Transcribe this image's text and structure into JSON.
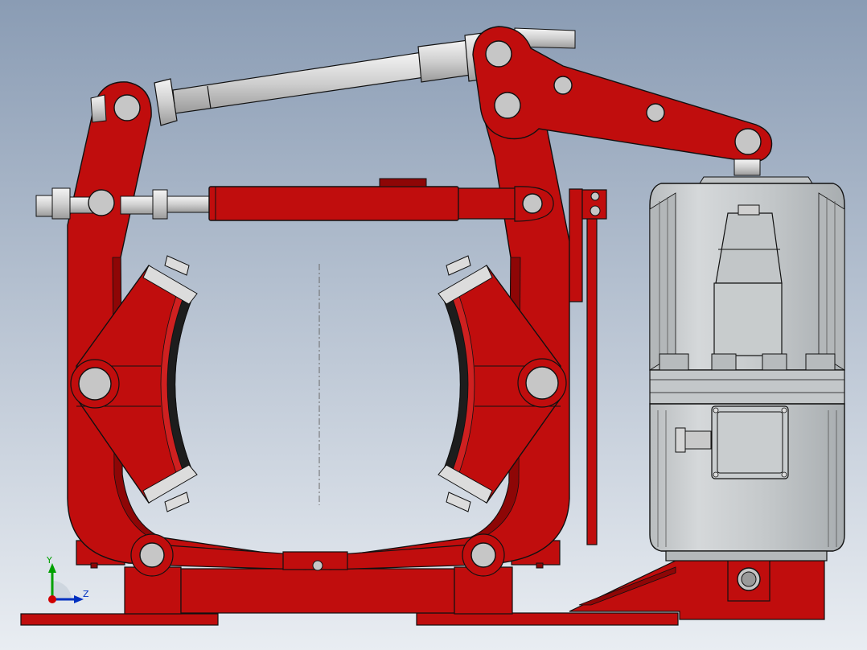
{
  "viewport": {
    "background_top": "#8a9cb4",
    "background_bottom": "#e9edf2"
  },
  "colors": {
    "frame_red": "#c00d0d",
    "frame_red_dark": "#8e0606",
    "frame_red_light": "#e02222",
    "steel_light": "#dcdcdc",
    "steel_mid": "#b8b8b8",
    "steel_dark": "#8f8f8f",
    "motor_body": "#c9cdcf",
    "motor_shadow": "#a9aeb1",
    "outline": "#111111",
    "pin_fill": "#c6c6c6",
    "lining_black": "#1d1d1d",
    "axis_green": "#00a000",
    "axis_blue": "#0030c0",
    "axis_red": "#d00000"
  },
  "triad": {
    "y_label": "Y",
    "z_label": "Z"
  }
}
